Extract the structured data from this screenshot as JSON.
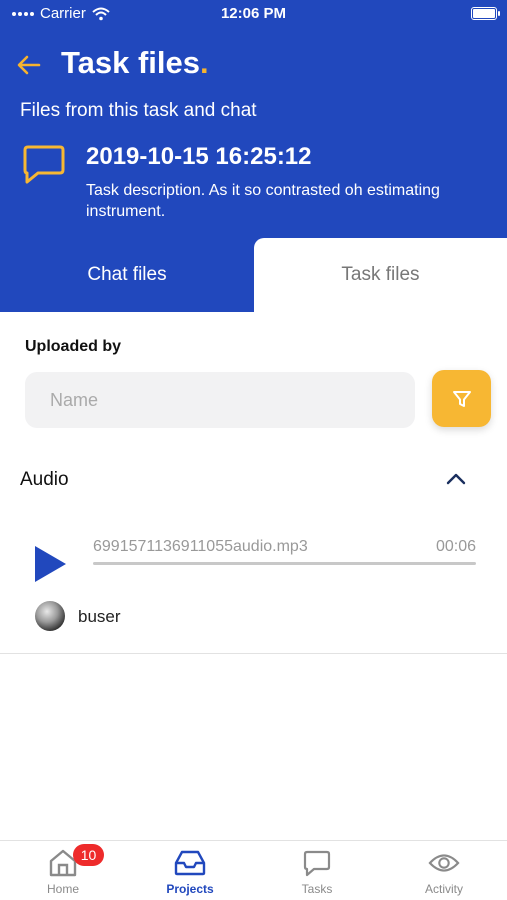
{
  "status_bar": {
    "carrier": "Carrier",
    "time": "12:06 PM"
  },
  "header": {
    "title": "Task files",
    "title_dot": ".",
    "subtitle": "Files from this task and chat",
    "task_date": "2019-10-15 16:25:12",
    "task_description": "Task description. As it so contrasted oh estimating instrument."
  },
  "tabs": [
    {
      "label": "Chat files",
      "active": true
    },
    {
      "label": "Task files",
      "active": false
    }
  ],
  "filter": {
    "uploaded_by_label": "Uploaded by",
    "name_placeholder": "Name",
    "name_value": ""
  },
  "audio_section": {
    "title": "Audio",
    "expanded": true,
    "items": [
      {
        "file_name": "6991571136911055audio.mp3",
        "duration": "00:06",
        "progress": 0.0,
        "uploader": "buser"
      }
    ]
  },
  "bottom_nav": [
    {
      "label": "Home",
      "icon": "home-icon",
      "badge": "10",
      "active": false
    },
    {
      "label": "Projects",
      "icon": "inbox-icon",
      "badge": "",
      "active": true
    },
    {
      "label": "Tasks",
      "icon": "chat-bubble-icon",
      "badge": "",
      "active": false
    },
    {
      "label": "Activity",
      "icon": "eye-icon",
      "badge": "",
      "active": false
    }
  ],
  "colors": {
    "primary": "#2148bd",
    "accent": "#f7b733",
    "badge": "#ee2b2b",
    "inactive": "#8a8a8a"
  }
}
